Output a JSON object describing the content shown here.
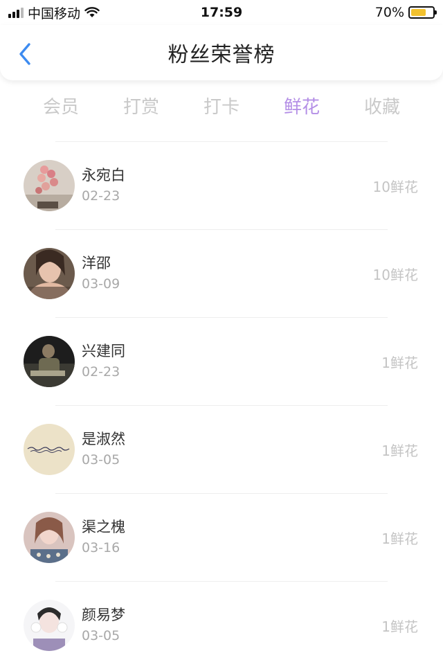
{
  "status_bar": {
    "carrier": "中国移动",
    "time": "17:59",
    "battery": "70%",
    "battery_level": 0.7,
    "battery_color": "#f2c12e"
  },
  "header": {
    "title": "粉丝荣誉榜",
    "back_icon": "chevron-left-icon"
  },
  "tabs": [
    {
      "label": "会员",
      "active": false
    },
    {
      "label": "打赏",
      "active": false
    },
    {
      "label": "打卡",
      "active": false
    },
    {
      "label": "鲜花",
      "active": true
    },
    {
      "label": "收藏",
      "active": false
    }
  ],
  "colors": {
    "accent": "#b48fe6",
    "back_icon": "#3d8bf0"
  },
  "fans": [
    {
      "name": "永宛白",
      "date": "02-23",
      "count": "10鲜花",
      "avatar": "balloons-photo"
    },
    {
      "name": "洋邵",
      "date": "03-09",
      "count": "10鲜花",
      "avatar": "woman-portrait"
    },
    {
      "name": "兴建同",
      "date": "02-23",
      "count": "1鲜花",
      "avatar": "dark-photo"
    },
    {
      "name": "是淑然",
      "date": "03-05",
      "count": "1鲜花",
      "avatar": "handwriting-photo"
    },
    {
      "name": "渠之槐",
      "date": "03-16",
      "count": "1鲜花",
      "avatar": "woman-portrait-pink"
    },
    {
      "name": "颜易梦",
      "date": "03-05",
      "count": "1鲜花",
      "avatar": "girl-portrait-white"
    }
  ]
}
